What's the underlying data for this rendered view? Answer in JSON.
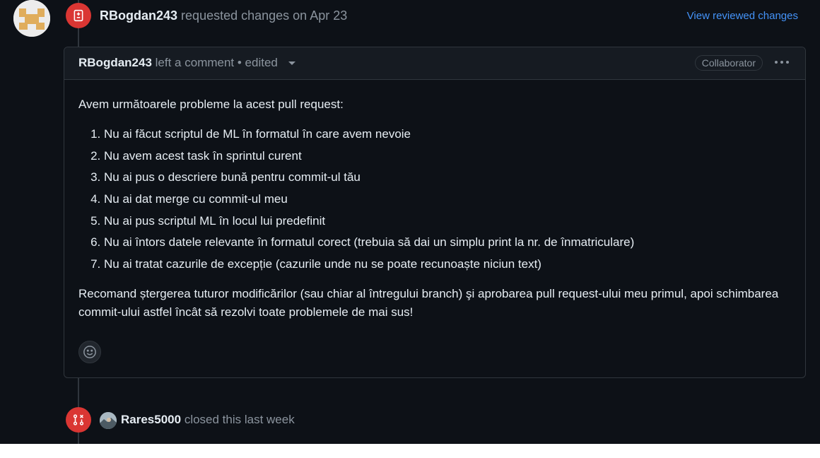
{
  "review": {
    "user": "RBogdan243",
    "action": "requested changes on Apr 23",
    "view_changes_link": "View reviewed changes",
    "icon": "file-diff-icon"
  },
  "comment": {
    "author": "RBogdan243",
    "meta": "left a comment • edited",
    "role_badge": "Collaborator",
    "more_icon": "kebab-horizontal-icon",
    "intro": "Avem următoarele probleme la acest pull request:",
    "items": [
      "Nu ai făcut scriptul de ML în formatul în care avem nevoie",
      "Nu avem acest task în sprintul curent",
      "Nu ai pus o descriere bună pentru commit-ul tău",
      "Nu ai dat merge cu commit-ul meu",
      "Nu ai pus scriptul ML în locul lui predefinit",
      "Nu ai întors datele relevante în formatul corect (trebuia să dai un simplu print la nr. de înmatriculare)",
      "Nu ai tratat cazurile de excepție (cazurile unde nu se poate recunoaște niciun text)"
    ],
    "outro": "Recomand ștergerea tuturor modificărilor (sau chiar al întregului branch) şi aprobarea pull request-ului meu primul, apoi schimbarea commit-ului astfel încât să rezolvi toate problemele de mai sus!",
    "reaction_icon": "smiley-icon"
  },
  "event": {
    "user": "Rares5000",
    "action": "closed this last week",
    "icon": "git-pull-request-closed-icon"
  },
  "colors": {
    "background": "#0d1117",
    "danger": "#da3633",
    "link": "#4493f8",
    "muted": "#8b949e",
    "text": "#e6edf3",
    "border": "#30363d"
  }
}
